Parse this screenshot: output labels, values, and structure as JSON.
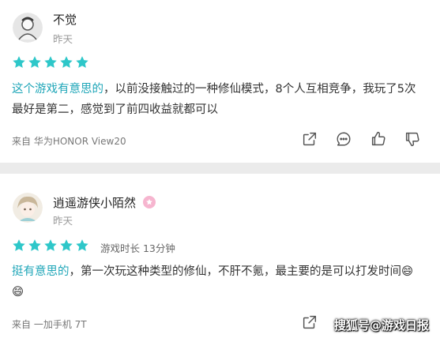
{
  "colors": {
    "star": "#2ec7c9",
    "highlight": "#1fa6b8",
    "separator": "#ebebeb",
    "badge": "#f6b5cf"
  },
  "reviews": [
    {
      "username": "不觉",
      "date": "昨天",
      "rating": 5,
      "highlight": "这个游戏有意思的",
      "text": "，以前没接触过的一种修仙模式，8个人互相竞争，我玩了5次最好是第二，感觉到了前四收益就都可以",
      "device": "来自 华为HONOR View20",
      "actions": [
        "share-icon",
        "comment-icon",
        "thumbs-up-icon",
        "thumbs-down-icon"
      ]
    },
    {
      "username": "逍遥游侠小陌然",
      "date": "昨天",
      "rating": 5,
      "playtime": "游戏时长 13分钟",
      "highlight": "挺有意思的",
      "text": "，第一次玩这种类型的修仙，不肝不氪，最主要的是可以打发时间😄😄",
      "device": "来自 一加手机 7T",
      "actions": [
        "share-icon"
      ]
    }
  ],
  "watermark": "搜狐号@游戏日报"
}
